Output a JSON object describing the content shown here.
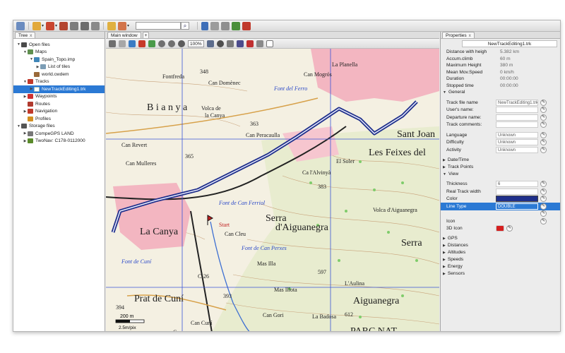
{
  "toolbar": {
    "search_value": "",
    "search_icon": "magnifier-icon"
  },
  "left_panel": {
    "tab_label": "Tree",
    "tab_close": "x",
    "tree": [
      {
        "label": "Open files",
        "depth": 0,
        "arrow": "▼",
        "icon": "folder-icon",
        "color": "#4a4a4a"
      },
      {
        "label": "Maps",
        "depth": 1,
        "arrow": "▼",
        "icon": "globe-icon",
        "color": "#5f8f4f"
      },
      {
        "label": "Spain_Topo.imp",
        "depth": 2,
        "arrow": "▼",
        "icon": "map-icon",
        "color": "#3f86b8"
      },
      {
        "label": "List of tiles",
        "depth": 3,
        "arrow": "▶",
        "icon": "tiles-icon",
        "color": "#7c9db5"
      },
      {
        "label": "world.cwdem",
        "depth": 2,
        "arrow": "",
        "icon": "dem-icon",
        "color": "#9a6a3a"
      },
      {
        "label": "Tracks",
        "depth": 1,
        "arrow": "▼",
        "icon": "track-icon",
        "color": "#c0392b"
      },
      {
        "label": "NewTrackEditing1.trk",
        "depth": 2,
        "arrow": "▶",
        "icon": "track-file-icon",
        "color": "#ffffff",
        "selected": true
      },
      {
        "label": "Waypoints",
        "depth": 1,
        "arrow": "▶",
        "icon": "waypoint-icon",
        "color": "#d03030"
      },
      {
        "label": "Routes",
        "depth": 1,
        "arrow": "",
        "icon": "route-icon",
        "color": "#b03a2e"
      },
      {
        "label": "Navigation",
        "depth": 1,
        "arrow": "▶",
        "icon": "navigation-icon",
        "color": "#c0392b"
      },
      {
        "label": "Profiles",
        "depth": 1,
        "arrow": "",
        "icon": "profile-icon",
        "color": "#d28f20"
      },
      {
        "label": "Storage files",
        "depth": 0,
        "arrow": "▼",
        "icon": "storage-icon",
        "color": "#555555"
      },
      {
        "label": "CompeGPS LAND",
        "depth": 1,
        "arrow": "▶",
        "icon": "disk-icon",
        "color": "#777777"
      },
      {
        "label": "TwoNav: C178-0112000",
        "depth": 1,
        "arrow": "▶",
        "icon": "device-icon",
        "color": "#5a8a2a"
      }
    ]
  },
  "map_panel": {
    "tab_label": "Main window",
    "tab_close": "x",
    "zoom_level": "100%",
    "scale_top": "200 m",
    "scale_bottom": "2.5m/pix",
    "labels": [
      {
        "text": "B i a n y a",
        "cls": "big"
      },
      {
        "text": "Fontfreda"
      },
      {
        "text": "Can Domènec"
      },
      {
        "text": "Volca de"
      },
      {
        "text": "la Canya"
      },
      {
        "text": "Can Mulleres"
      },
      {
        "text": "Can Revert"
      },
      {
        "text": "Can Peracaulla"
      },
      {
        "text": "Can Mogrós"
      },
      {
        "text": "La Planella"
      },
      {
        "text": "Sant Joan",
        "cls": "big"
      },
      {
        "text": "Les Feixes del",
        "cls": "big"
      },
      {
        "text": "Font del Ferro",
        "cls": "blue"
      },
      {
        "text": "Font de Can Ferriol",
        "cls": "blue"
      },
      {
        "text": "Font de Can Perxes",
        "cls": "blue"
      },
      {
        "text": "El Soler"
      },
      {
        "text": "Ca l'Alvinyà"
      },
      {
        "text": "Serra",
        "cls": "big"
      },
      {
        "text": "d'Aiguanegra",
        "cls": "big"
      },
      {
        "text": "Volca d'Aiguanegra"
      },
      {
        "text": "Serra",
        "cls": "big"
      },
      {
        "text": "La Canya",
        "cls": "big"
      },
      {
        "text": "Start",
        "cls": "red"
      },
      {
        "text": "Can Cleu"
      },
      {
        "text": "Font de Cuní",
        "cls": "blue"
      },
      {
        "text": "Mas Illa"
      },
      {
        "text": "Prat de Cuní",
        "cls": "big"
      },
      {
        "text": "C-26"
      },
      {
        "text": "Mas Illota"
      },
      {
        "text": "Can Gori"
      },
      {
        "text": "L'Aulina"
      },
      {
        "text": "Aiguanegra",
        "cls": "big"
      },
      {
        "text": "La Badosa"
      },
      {
        "text": "PARC NAT",
        "cls": "big"
      },
      {
        "text": "Cura"
      },
      {
        "text": "Can Cuní"
      },
      {
        "text": "348"
      },
      {
        "text": "363"
      },
      {
        "text": "365"
      },
      {
        "text": "383"
      },
      {
        "text": "597"
      },
      {
        "text": "393"
      },
      {
        "text": "394"
      },
      {
        "text": "612"
      }
    ]
  },
  "right_panel": {
    "tab_label": "Properties",
    "tab_close": "x",
    "track_title": "NewTrackEditing1.trk",
    "stats": [
      {
        "k": "Distance with heigh",
        "v": "5.382 km"
      },
      {
        "k": "Accum.climb",
        "v": "60 m"
      },
      {
        "k": "Maximum Height",
        "v": "380 m"
      },
      {
        "k": "Mean Mov.Speed",
        "v": "0 km/h"
      },
      {
        "k": "Duration",
        "v": "00:00:00"
      },
      {
        "k": "Stopped time",
        "v": "00:00:00"
      }
    ],
    "section_general": "General",
    "general_fields": [
      {
        "k": "Track file name",
        "v": "NewTrackEditing1.trk"
      },
      {
        "k": "User's name:",
        "v": ""
      },
      {
        "k": "Departure name:",
        "v": ""
      },
      {
        "k": "Track comments:",
        "v": ""
      }
    ],
    "general_fields_2": [
      {
        "k": "Language",
        "v": "Unknown"
      },
      {
        "k": "Difficulty",
        "v": "Unknown"
      },
      {
        "k": "Activity",
        "v": "Unknown"
      }
    ],
    "section_datetime": "Date/Time",
    "section_trackpoints": "Track Points",
    "section_view": "View",
    "view_fields": [
      {
        "k": "Thickness",
        "v": "6"
      },
      {
        "k": "Real Track width",
        "v": ""
      },
      {
        "k": "Color",
        "v": "",
        "color": "#1f2f8a"
      },
      {
        "k": "Line Type",
        "v": "DOUBLE",
        "selected": true
      },
      {
        "k": "",
        "v": ""
      },
      {
        "k": "Icon",
        "v": ""
      },
      {
        "k": "3D Icon",
        "v": "",
        "color": "#d51f1f"
      }
    ],
    "sections_bottom": [
      "GPS",
      "Distances",
      "Altitudes",
      "Speeds",
      "Energy",
      "Sensors"
    ]
  }
}
